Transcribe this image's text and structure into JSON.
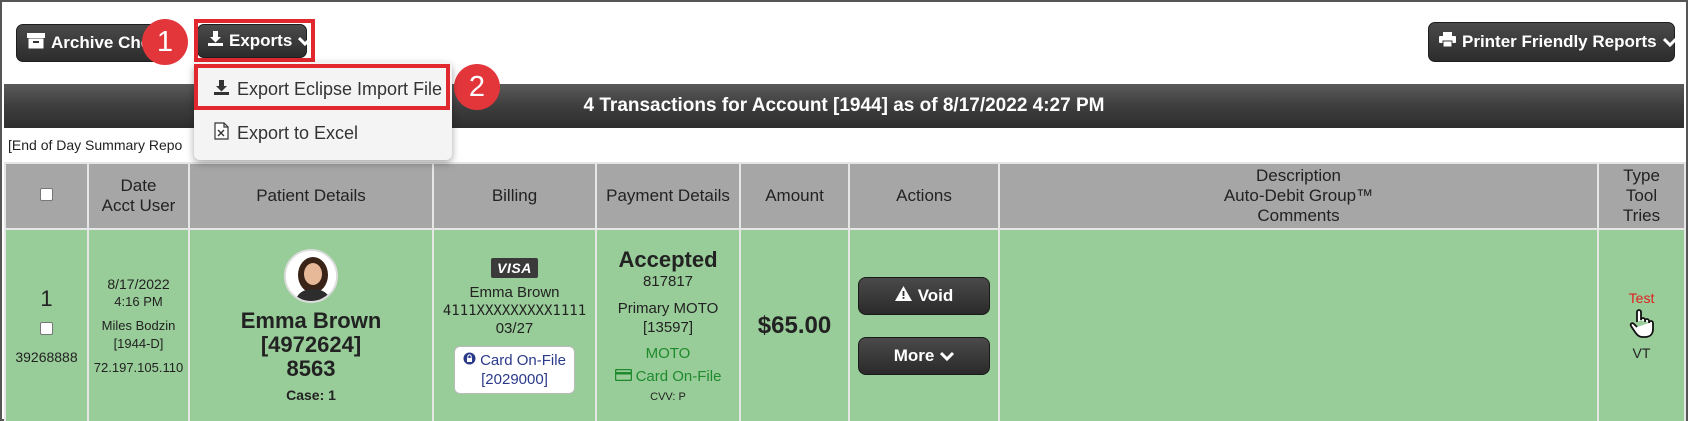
{
  "toolbar": {
    "archive_label": "Archive Che",
    "exports_label": "Exports",
    "printer_label": "Printer Friendly Reports"
  },
  "steps": {
    "one": "1",
    "two": "2"
  },
  "export_menu": {
    "items": [
      {
        "label": "Export Eclipse Import File"
      },
      {
        "label": "Export to Excel"
      }
    ]
  },
  "title_bar": {
    "text": "4 Transactions for Account [1944] as of 8/17/2022 4:27 PM"
  },
  "eod_link": "[End of Day Summary Repo",
  "table": {
    "headers": {
      "date_l1": "Date",
      "date_l2": "Acct User",
      "patient": "Patient Details",
      "billing": "Billing",
      "payment": "Payment Details",
      "amount": "Amount",
      "actions": "Actions",
      "desc_l1": "Description",
      "desc_l2": "Auto-Debit Group™",
      "desc_l3": "Comments",
      "type_l1": "Type",
      "type_l2": "Tool",
      "type_l3": "Tries"
    },
    "rows": [
      {
        "num": "1",
        "id": "39268888",
        "date": "8/17/2022",
        "time": "4:16 PM",
        "user": "Miles Bodzin",
        "acct": "[1944-D]",
        "ip": "72.197.105.110",
        "patient_name": "Emma Brown [4972624]",
        "patient_code": "8563",
        "case": "Case: 1",
        "card_brand": "VISA",
        "card_holder": "Emma Brown",
        "card_number": "4111XXXXXXXXX1111",
        "card_exp": "03/27",
        "card_on_file": "Card On-File",
        "card_on_file_id": "[2029000]",
        "status": "Accepted",
        "auth_code": "817817",
        "processor": "Primary MOTO",
        "processor_id": "[13597]",
        "entry_mode": "MOTO",
        "card_on_file_status": "Card On-File",
        "cvv": "CVV: P",
        "amount": "$65.00",
        "void_label": "Void",
        "more_label": "More",
        "type_link": "Test",
        "tool": "VT"
      }
    ]
  },
  "colors": {
    "row_accepted": "#98cc98",
    "header_gray": "#a6a6a6",
    "highlight_red": "#e2282f",
    "moto_green": "#1f8a2d"
  }
}
